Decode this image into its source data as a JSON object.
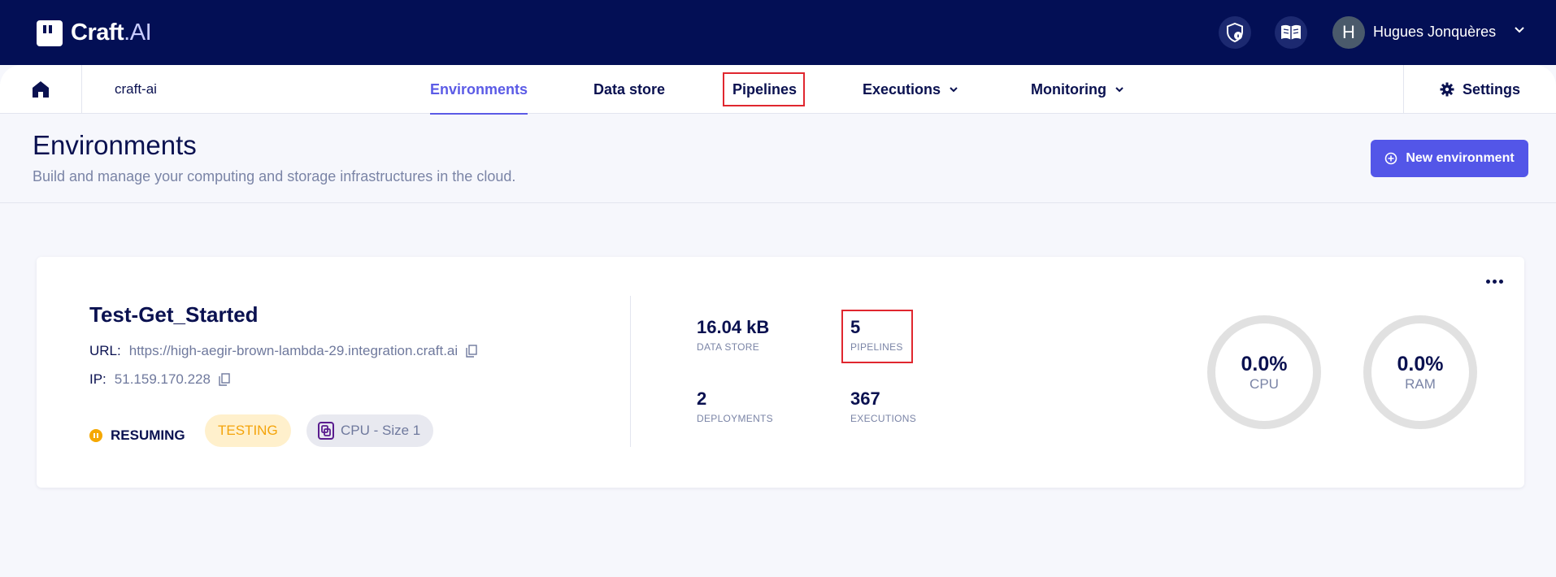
{
  "app": {
    "logo_main": "Craft",
    "logo_ai": ".AI"
  },
  "topbar": {
    "user_initial": "H",
    "user_name": "Hugues Jonquères"
  },
  "nav": {
    "org": "craft-ai",
    "items": [
      {
        "label": "Environments",
        "active": true
      },
      {
        "label": "Data store"
      },
      {
        "label": "Pipelines"
      },
      {
        "label": "Executions"
      },
      {
        "label": "Monitoring"
      }
    ],
    "settings": "Settings"
  },
  "header": {
    "title": "Environments",
    "subtitle": "Build and manage your computing and storage infrastructures in the cloud.",
    "new_button": "New environment"
  },
  "environment": {
    "name": "Test-Get_Started",
    "url_label": "URL:",
    "url": "https://high-aegir-brown-lambda-29.integration.craft.ai",
    "ip_label": "IP:",
    "ip": "51.159.170.228",
    "status": "RESUMING",
    "tag": "TESTING",
    "size": "CPU - Size 1",
    "stats": {
      "data_store": {
        "value": "16.04 kB",
        "label": "DATA STORE"
      },
      "pipelines": {
        "value": "5",
        "label": "PIPELINES"
      },
      "deployments": {
        "value": "2",
        "label": "DEPLOYMENTS"
      },
      "executions": {
        "value": "367",
        "label": "EXECUTIONS"
      }
    },
    "cpu": {
      "value": "0.0%",
      "label": "CPU"
    },
    "ram": {
      "value": "0.0%",
      "label": "RAM"
    }
  },
  "colors": {
    "topbar": "#030f55",
    "accent": "#5b5be6",
    "highlight": "#e0272f",
    "warning": "#f5a800"
  }
}
